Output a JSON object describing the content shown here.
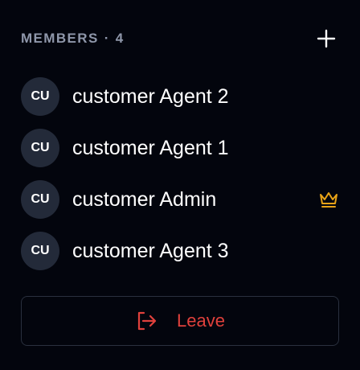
{
  "members": {
    "heading": "MEMBERS",
    "separator": "·",
    "count": "4",
    "add_icon": "plus-icon",
    "items": [
      {
        "initials": "CU",
        "name": "customer Agent 2",
        "is_owner": false
      },
      {
        "initials": "CU",
        "name": "customer Agent 1",
        "is_owner": false
      },
      {
        "initials": "CU",
        "name": "customer Admin",
        "is_owner": true,
        "badge_icon": "crown-icon"
      },
      {
        "initials": "CU",
        "name": "customer Agent 3",
        "is_owner": false
      }
    ]
  },
  "leave_button": {
    "label": "Leave",
    "icon": "exit-icon"
  },
  "colors": {
    "background": "#03050d",
    "heading": "#8f97aa",
    "avatar_bg": "#232a39",
    "crown": "#e8a317",
    "leave": "#e0413c",
    "border": "#2a303e"
  }
}
